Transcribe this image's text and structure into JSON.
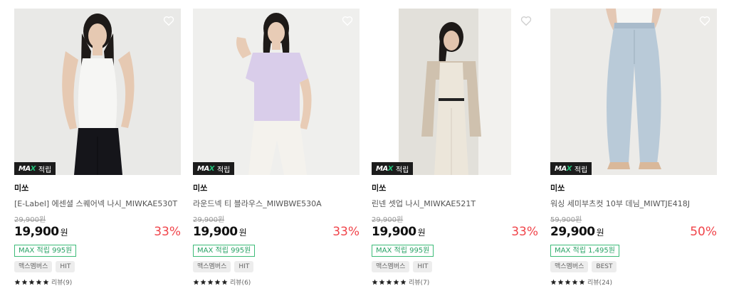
{
  "products": [
    {
      "brand": "미쏘",
      "name": "[E-Label] 에센셜 스퀘어넥 나시_MIWKAE530T",
      "original_price": "29,900원",
      "price": "19,900",
      "currency": "원",
      "discount": "33%",
      "max_badge": "적립",
      "point": "MAX 적립 995원",
      "tags": [
        "맥스멤버스",
        "HIT"
      ],
      "rating": 5,
      "reviews": "리뷰(9)"
    },
    {
      "brand": "미쏘",
      "name": "라운드넥 티 블라우스_MIWBWE530A",
      "original_price": "29,900원",
      "price": "19,900",
      "currency": "원",
      "discount": "33%",
      "max_badge": "적립",
      "point": "MAX 적립 995원",
      "tags": [
        "맥스멤버스",
        "HIT"
      ],
      "rating": 5,
      "reviews": "리뷰(6)"
    },
    {
      "brand": "미쏘",
      "name": "린넨 셋업 나시_MIWKAE521T",
      "original_price": "29,900원",
      "price": "19,900",
      "currency": "원",
      "discount": "33%",
      "max_badge": "적립",
      "point": "MAX 적립 995원",
      "tags": [
        "맥스멤버스",
        "HIT"
      ],
      "rating": 5,
      "reviews": "리뷰(7)"
    },
    {
      "brand": "미쏘",
      "name": "워싱 세미부츠컷 10부 데님_MIWTJE418J",
      "original_price": "59,900원",
      "price": "29,900",
      "currency": "원",
      "discount": "50%",
      "max_badge": "적립",
      "point": "MAX 적립 1,495원",
      "tags": [
        "맥스멤버스",
        "BEST"
      ],
      "rating": 5,
      "reviews": "리뷰(24)"
    }
  ],
  "colors": {
    "discount": "#f0444a",
    "point_border": "#3dbb78",
    "badge_bg": "#1c1c1c",
    "max_accent": "#22c17a"
  },
  "icons": {
    "wishlist": "heart-outline-icon",
    "rating": "star-icon"
  }
}
